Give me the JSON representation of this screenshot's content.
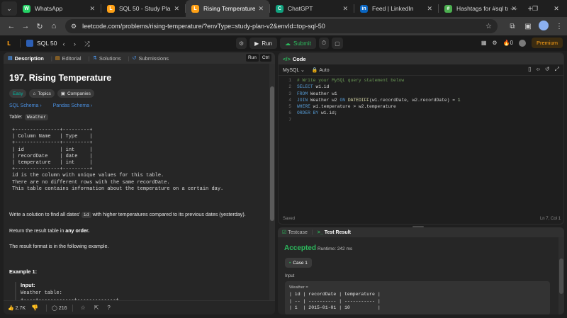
{
  "browser": {
    "tabs": [
      {
        "label": "WhatsApp",
        "icon": "whatsapp-icon",
        "color": "#25d366",
        "glyph": "W"
      },
      {
        "label": "SQL 50 - Study Plan -",
        "icon": "leetcode-icon",
        "color": "#ffa116",
        "glyph": "L"
      },
      {
        "label": "Rising Temperature -",
        "icon": "leetcode-icon",
        "color": "#ffa116",
        "glyph": "L",
        "active": true
      },
      {
        "label": "ChatGPT",
        "icon": "chatgpt-icon",
        "color": "#10a37f",
        "glyph": "C"
      },
      {
        "label": "Feed | LinkedIn",
        "icon": "linkedin-icon",
        "color": "#0a66c2",
        "glyph": "in"
      },
      {
        "label": "Hashtags for #sql to",
        "icon": "hashtag-site-icon",
        "color": "#4caf50",
        "glyph": "#"
      }
    ],
    "url": "leetcode.com/problems/rising-temperature/?envType=study-plan-v2&envId=top-sql-50"
  },
  "lc_nav": {
    "study_plan": "SQL 50",
    "run": "Run",
    "submit": "Submit",
    "streak": "0",
    "premium": "Premium"
  },
  "problem": {
    "tabs": {
      "description": "Description",
      "editorial": "Editorial",
      "solutions": "Solutions",
      "submissions": "Submissions"
    },
    "run_hint": "Run",
    "run_hint_key": "Ctrl",
    "title": "197. Rising Temperature",
    "difficulty": "Easy",
    "topics": "Topics",
    "companies": "Companies",
    "sql_schema": "SQL Schema",
    "pandas_schema": "Pandas Schema",
    "table_label": "Table:",
    "table_name": "Weather",
    "schema": "+---------------+---------+\n| Column Name   | Type    |\n+---------------+---------+\n| id            | int     |\n| recordDate    | date    |\n| temperature   | int     |\n+---------------+---------+\nid is the column with unique values for this table.\nThere are no different rows with the same recordDate.\nThis table contains information about the temperature on a certain day.",
    "task_pre": "Write a solution to find all dates'",
    "task_code": "id",
    "task_post": "with higher temperatures compared to its previous dates (yesterday).",
    "order_pre": "Return the result table in",
    "order_bold": "any order.",
    "format": "The result format is in the following example.",
    "example_title": "Example 1:",
    "input_label": "Input:",
    "example_text": "Weather table:\n+----+------------+-------------+\n| id | recordDate | temperature |"
  },
  "footer": {
    "likes": "2.7K",
    "comments": "216"
  },
  "editor": {
    "title": "Code",
    "language": "MySQL",
    "auto": "Auto",
    "status_left": "Saved",
    "status_right": "Ln 7, Col 1",
    "line_numbers": [
      "1",
      "2",
      "3",
      "4",
      "5",
      "6",
      "7"
    ]
  },
  "testpanel": {
    "testcase_tab": "Testcase",
    "result_tab": "Test Result",
    "verdict": "Accepted",
    "runtime": "Runtime: 242 ms",
    "case": "Case 1",
    "input_label": "Input",
    "weather_label": "Weather =",
    "table": "| id | recordDate | temperature |\n| -- | ---------- | ----------- |\n| 1  | 2015-01-01 | 10          |"
  }
}
